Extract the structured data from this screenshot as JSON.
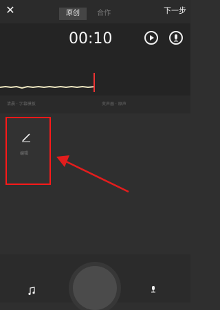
{
  "toolbar": {
    "close_label": "✕",
    "tabs": [
      "原创",
      "合作"
    ],
    "next_label": "下一步"
  },
  "recorder": {
    "timer": "00:10"
  },
  "labels": {
    "left": "清晨  · 字幕模板",
    "right": "变声器 · 原声"
  },
  "edit_panel": {
    "label": "编辑"
  },
  "colors": {
    "accent": "#ff1919",
    "cursor": "#e33333",
    "dark_bg": "#2f2f2f"
  }
}
